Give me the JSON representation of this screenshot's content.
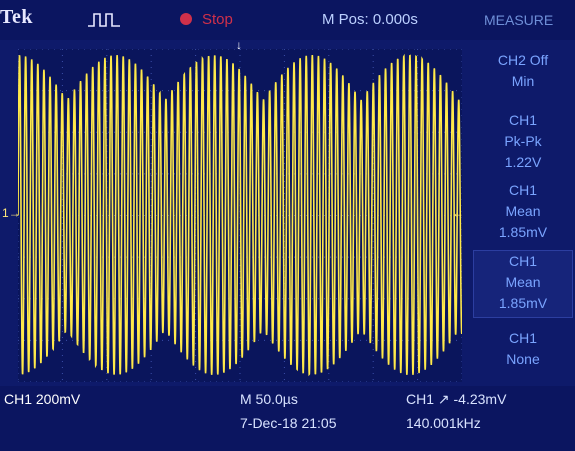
{
  "header": {
    "brand": "Tek",
    "run_state": "Stop",
    "m_pos": "M Pos: 0.000s",
    "menu_title": "MEASURE"
  },
  "markers": {
    "ch1_ref": "1→",
    "trigger_level": "←",
    "trigger_position": "↓"
  },
  "measurements": [
    {
      "line1": "CH2 Off",
      "line2": "Min",
      "line3": ""
    },
    {
      "line1": "CH1",
      "line2": "Pk-Pk",
      "line3": "1.22V"
    },
    {
      "line1": "CH1",
      "line2": "Mean",
      "line3": "1.85mV"
    },
    {
      "line1": "CH1",
      "line2": "Mean",
      "line3": "1.85mV"
    },
    {
      "line1": "CH1",
      "line2": "None",
      "line3": ""
    }
  ],
  "status": {
    "ch1_scale": "CH1  200mV",
    "timebase": "M 50.0µs",
    "datetime": "7-Dec-18 21:05",
    "trigger": "CH1 ↗ -4.23mV",
    "frequency": "140.001kHz"
  },
  "colors": {
    "trace": "#ffe94a",
    "background": "#0e1a6a",
    "label": "#7aa4ff",
    "stop": "#d0304a"
  }
}
